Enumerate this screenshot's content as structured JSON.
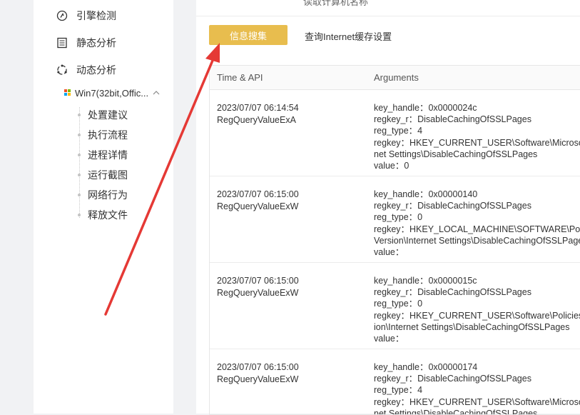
{
  "sidebar": {
    "items": [
      {
        "label": "引擎检测",
        "icon": "engine-check-icon"
      },
      {
        "label": "静态分析",
        "icon": "static-analysis-icon"
      },
      {
        "label": "动态分析",
        "icon": "dynamic-analysis-icon"
      }
    ],
    "env_label": "Win7(32bit,Offic...",
    "leaves": [
      "处置建议",
      "执行流程",
      "进程详情",
      "运行截图",
      "网络行为",
      "释放文件"
    ]
  },
  "main": {
    "top_cut_text": "读取计算机名称",
    "button_label": "信息搜集",
    "title": "查询Internet缓存设置",
    "columns": [
      "Time & API",
      "Arguments"
    ],
    "rows": [
      {
        "time": "2023/07/07 06:14:54",
        "api": "RegQueryValueExA",
        "args": [
          "key_handle：0x0000024c",
          "regkey_r：DisableCachingOfSSLPages",
          "reg_type：4",
          "regkey：HKEY_CURRENT_USER\\Software\\Microsoft\\Windows\\CurrentVersion\\Inter",
          "net Settings\\DisableCachingOfSSLPages",
          "value：0"
        ]
      },
      {
        "time": "2023/07/07 06:15:00",
        "api": "RegQueryValueExW",
        "args": [
          "key_handle：0x00000140",
          "regkey_r：DisableCachingOfSSLPages",
          "reg_type：0",
          "regkey：HKEY_LOCAL_MACHINE\\SOFTWARE\\Policies\\Microsoft\\Windows\\Current",
          "Version\\Internet Settings\\DisableCachingOfSSLPages",
          "value："
        ]
      },
      {
        "time": "2023/07/07 06:15:00",
        "api": "RegQueryValueExW",
        "args": [
          "key_handle：0x0000015c",
          "regkey_r：DisableCachingOfSSLPages",
          "reg_type：0",
          "regkey：HKEY_CURRENT_USER\\Software\\Policies\\Microsoft\\Windows\\CurrentVers",
          "ion\\Internet Settings\\DisableCachingOfSSLPages",
          "value："
        ]
      },
      {
        "time": "2023/07/07 06:15:00",
        "api": "RegQueryValueExW",
        "args": [
          "key_handle：0x00000174",
          "regkey_r：DisableCachingOfSSLPages",
          "reg_type：4",
          "regkey：HKEY_CURRENT_USER\\Software\\Microsoft\\Windows\\CurrentVersion\\Inter",
          "net Settings\\DisableCachingOfSSLPages",
          ""
        ]
      }
    ]
  },
  "colors": {
    "accent": "#e8bd4e",
    "annotation": "#e53935"
  }
}
